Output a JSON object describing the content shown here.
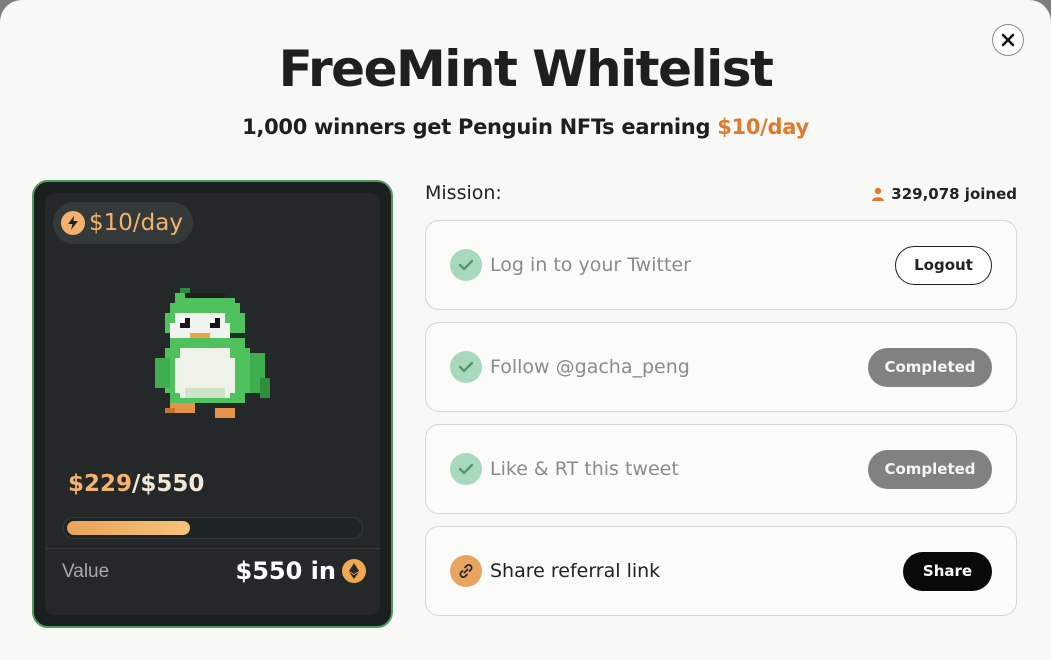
{
  "modal": {
    "title": "FreeMint Whitelist",
    "subtitle_prefix": "1,000 winners get Penguin NFTs earning ",
    "subtitle_highlight": "$10/day",
    "close_icon": "close-icon"
  },
  "card": {
    "rate": "$10/day",
    "progress_current": "$229",
    "progress_separator": "/",
    "progress_total": "$550",
    "progress_fraction": 0.42,
    "value_label": "Value",
    "value_amount": "$550 in",
    "value_icon": "eth-icon",
    "border_color": "#4f9a5c",
    "accent_color": "#f3b36e"
  },
  "mission": {
    "label": "Mission:",
    "joined": "329,078 joined",
    "tasks": [
      {
        "label": "Log in to your Twitter",
        "button": "Logout",
        "status": "done"
      },
      {
        "label": "Follow @gacha_peng",
        "button": "Completed",
        "status": "done"
      },
      {
        "label": "Like & RT this tweet",
        "button": "Completed",
        "status": "done"
      },
      {
        "label": "Share referral link",
        "button": "Share",
        "status": "pending"
      }
    ]
  },
  "colors": {
    "accent": "#e07a2f",
    "check_green": "#a9d9bd",
    "completed_gray": "#818180"
  }
}
